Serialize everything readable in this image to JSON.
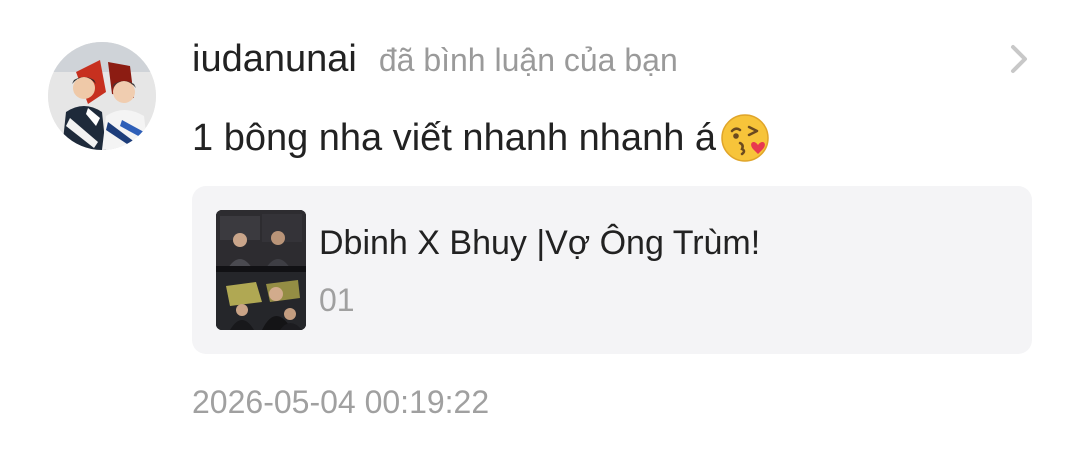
{
  "notification": {
    "username": "iudanunai",
    "action_text": "đã bình luận của bạn",
    "comment_text": "1 bông nha viết nhanh nhanh á",
    "comment_emoji": "face-throwing-kiss-emoji",
    "avatar": "user-avatar-photo",
    "chevron_icon": "chevron-right-icon",
    "timestamp": "2026-05-04 00:19:22",
    "story_card": {
      "cover": "story-cover-photo",
      "title": "Dbinh X Bhuy |Vợ Ông Trùm!",
      "subtitle": "01"
    }
  },
  "colors": {
    "primary_text": "#222222",
    "secondary_text": "#9a9a9a",
    "card_background": "#f4f4f6",
    "chevron": "#c8c8c8"
  }
}
